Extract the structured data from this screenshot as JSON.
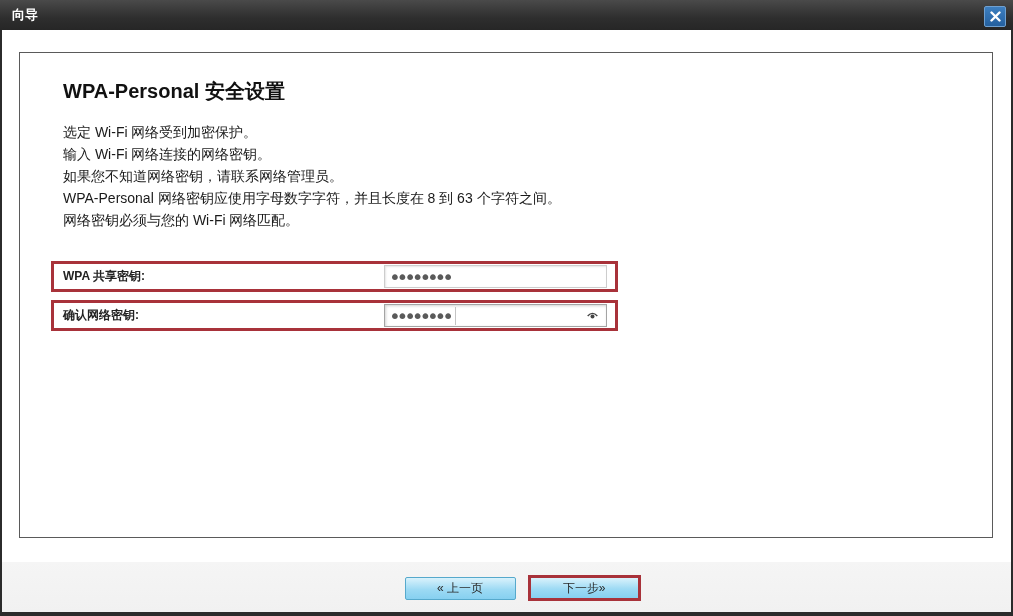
{
  "window": {
    "title": "向导"
  },
  "heading": "WPA-Personal 安全设置",
  "description_lines": [
    "选定 Wi-Fi 网络受到加密保护。",
    "输入 Wi-Fi 网络连接的网络密钥。",
    "如果您不知道网络密钥，请联系网络管理员。",
    "WPA-Personal 网络密钥应使用字母数字字符，并且长度在 8 到 63 个字符之间。",
    "网络密钥必须与您的 Wi-Fi 网络匹配。"
  ],
  "fields": [
    {
      "label": "WPA 共享密钥:",
      "value": "••••••••",
      "focused": false,
      "highlighted": true
    },
    {
      "label": "确认网络密钥:",
      "value": "••••••••",
      "focused": true,
      "highlighted": true
    }
  ],
  "buttons": [
    {
      "label": "« 上一页",
      "highlighted": false
    },
    {
      "label": "下一步»",
      "highlighted": true
    }
  ]
}
